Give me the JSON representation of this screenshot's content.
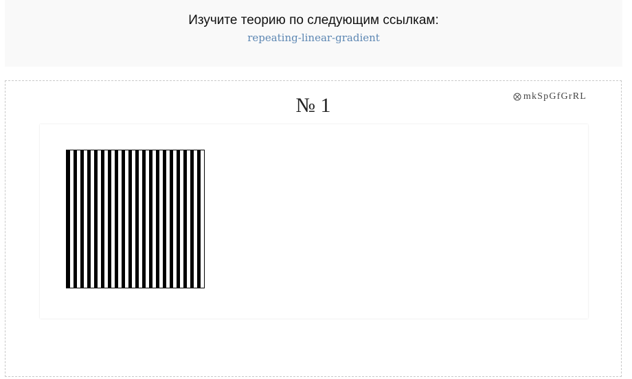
{
  "header": {
    "title": "Изучите теорию по следующим ссылкам:",
    "link_label": "repeating-linear-gradient"
  },
  "task": {
    "number_label": "№ 1",
    "id_icon": "circled-x-icon",
    "id_label": "mkSpGfGrRL"
  },
  "preview": {
    "pattern": "vertical-black-white-stripes",
    "colors": {
      "stripe_dark": "#000000",
      "stripe_light": "#ffffff",
      "link": "#5d87b3",
      "header_bg": "#f9f9f9"
    }
  }
}
